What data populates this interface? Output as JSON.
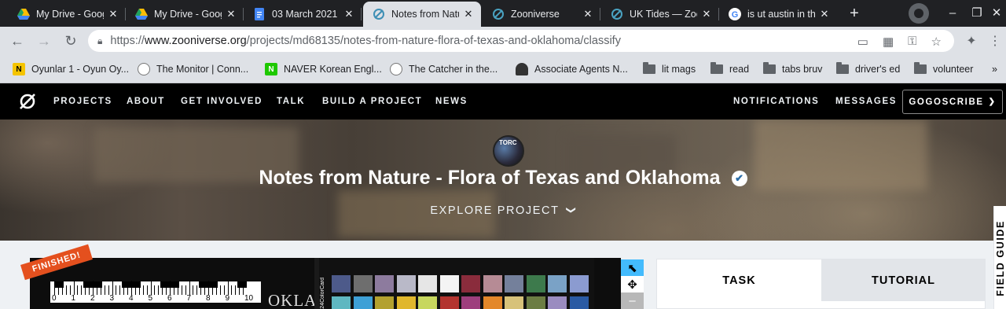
{
  "browser": {
    "tabs": [
      {
        "title": "My Drive - Google Drive",
        "icon": "google-drive-icon",
        "active": false
      },
      {
        "title": "My Drive - Google Drive",
        "icon": "google-drive-icon",
        "active": false
      },
      {
        "title": "03 March 2021",
        "icon": "google-docs-icon",
        "active": false
      },
      {
        "title": "Notes from Nature",
        "icon": "zooniverse-icon",
        "active": true
      },
      {
        "title": "Zooniverse",
        "icon": "zooniverse-icon",
        "active": false
      },
      {
        "title": "UK Tides — Zooniverse",
        "icon": "zooniverse-icon",
        "active": false
      },
      {
        "title": "is ut austin in the",
        "icon": "google-icon",
        "active": false
      }
    ],
    "close_glyph": "✕",
    "new_tab_glyph": "+",
    "url": {
      "scheme": "https://",
      "host": "www.zooniverse.org",
      "path": "/projects/md68135/notes-from-nature-flora-of-texas-and-oklahoma/classify"
    },
    "bookmarks": [
      {
        "label": "Oyunlar 1 - Oyun Oy...",
        "icon": "yellow-n-icon"
      },
      {
        "label": "The Monitor | Conn...",
        "icon": "globe-icon"
      },
      {
        "label": "NAVER Korean Engl...",
        "icon": "naver-icon"
      },
      {
        "label": "The Catcher in the...",
        "icon": "globe-icon"
      },
      {
        "label": "Associate Agents N...",
        "icon": "agent-icon"
      },
      {
        "label": "lit mags",
        "icon": "folder-icon"
      },
      {
        "label": "read",
        "icon": "folder-icon"
      },
      {
        "label": "tabs bruv",
        "icon": "folder-icon"
      },
      {
        "label": "driver's ed",
        "icon": "folder-icon"
      },
      {
        "label": "volunteer",
        "icon": "folder-icon"
      }
    ],
    "bookmarks_overflow": "»"
  },
  "site_nav": {
    "links": [
      "PROJECTS",
      "ABOUT",
      "GET INVOLVED",
      "TALK",
      "BUILD A PROJECT",
      "NEWS"
    ],
    "right_links": [
      "NOTIFICATIONS",
      "MESSAGES"
    ],
    "user": "GOGOSCRIBE"
  },
  "hero": {
    "avatar_text": "TORC",
    "title": "Notes from Nature - Flora of Texas and Oklahoma",
    "explore": "EXPLORE PROJECT"
  },
  "subject": {
    "badge": "FINISHED!",
    "ruler_numbers": [
      "0",
      "1",
      "2",
      "3",
      "4",
      "5",
      "6",
      "7",
      "8",
      "9",
      "10"
    ],
    "label_text": "OKLA",
    "card_label": "24ColorCard",
    "swatch_colors": [
      "#4d5a8a",
      "#6e6e6e",
      "#8d7b9e",
      "#b9b9c8",
      "#e6e6e6",
      "#f4f4f4",
      "#8a2c3c",
      "#b68b95",
      "#74809b",
      "#3d7a4c",
      "#7aa2c6",
      "#8b9bd0",
      "#5fb7c1",
      "#3ea0d6",
      "#b3a12f",
      "#e0b72c",
      "#c7d75e",
      "#b3342f",
      "#9e3f7d",
      "#e3872a",
      "#d7c27a",
      "#6c7d43",
      "#9a8cc0",
      "#2a5aa3"
    ]
  },
  "tools": [
    {
      "name": "pointer-tool",
      "glyph": "⬉"
    },
    {
      "name": "move-tool",
      "glyph": "✥"
    },
    {
      "name": "zoom-out-tool",
      "glyph": "–"
    }
  ],
  "panel": {
    "tabs": [
      "TASK",
      "TUTORIAL"
    ]
  },
  "field_guide": "FIELD GUIDE"
}
